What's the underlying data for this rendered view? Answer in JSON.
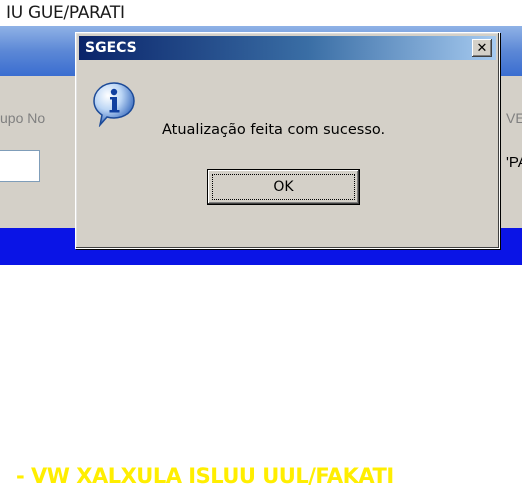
{
  "background_app": {
    "title_text": "IU GUE/PARATI",
    "label_left": "upo No",
    "label_right": "VE",
    "field_right_text": "'PA",
    "bottom_banner": "- VW XALXULA ISLUU UUL/FAKATI",
    "colors": {
      "blue_band": "#5c88d6",
      "bottom_bar": "#0a14e6",
      "bottom_text": "#ffee00"
    }
  },
  "dialog": {
    "title": "SGECS",
    "close_label": "✕",
    "icon": "info-icon",
    "message": "Atualização feita com sucesso.",
    "ok_label": "OK",
    "colors": {
      "titlebar_start": "#0a246a",
      "titlebar_end": "#a6caf0",
      "face": "#d4d0c8"
    }
  }
}
